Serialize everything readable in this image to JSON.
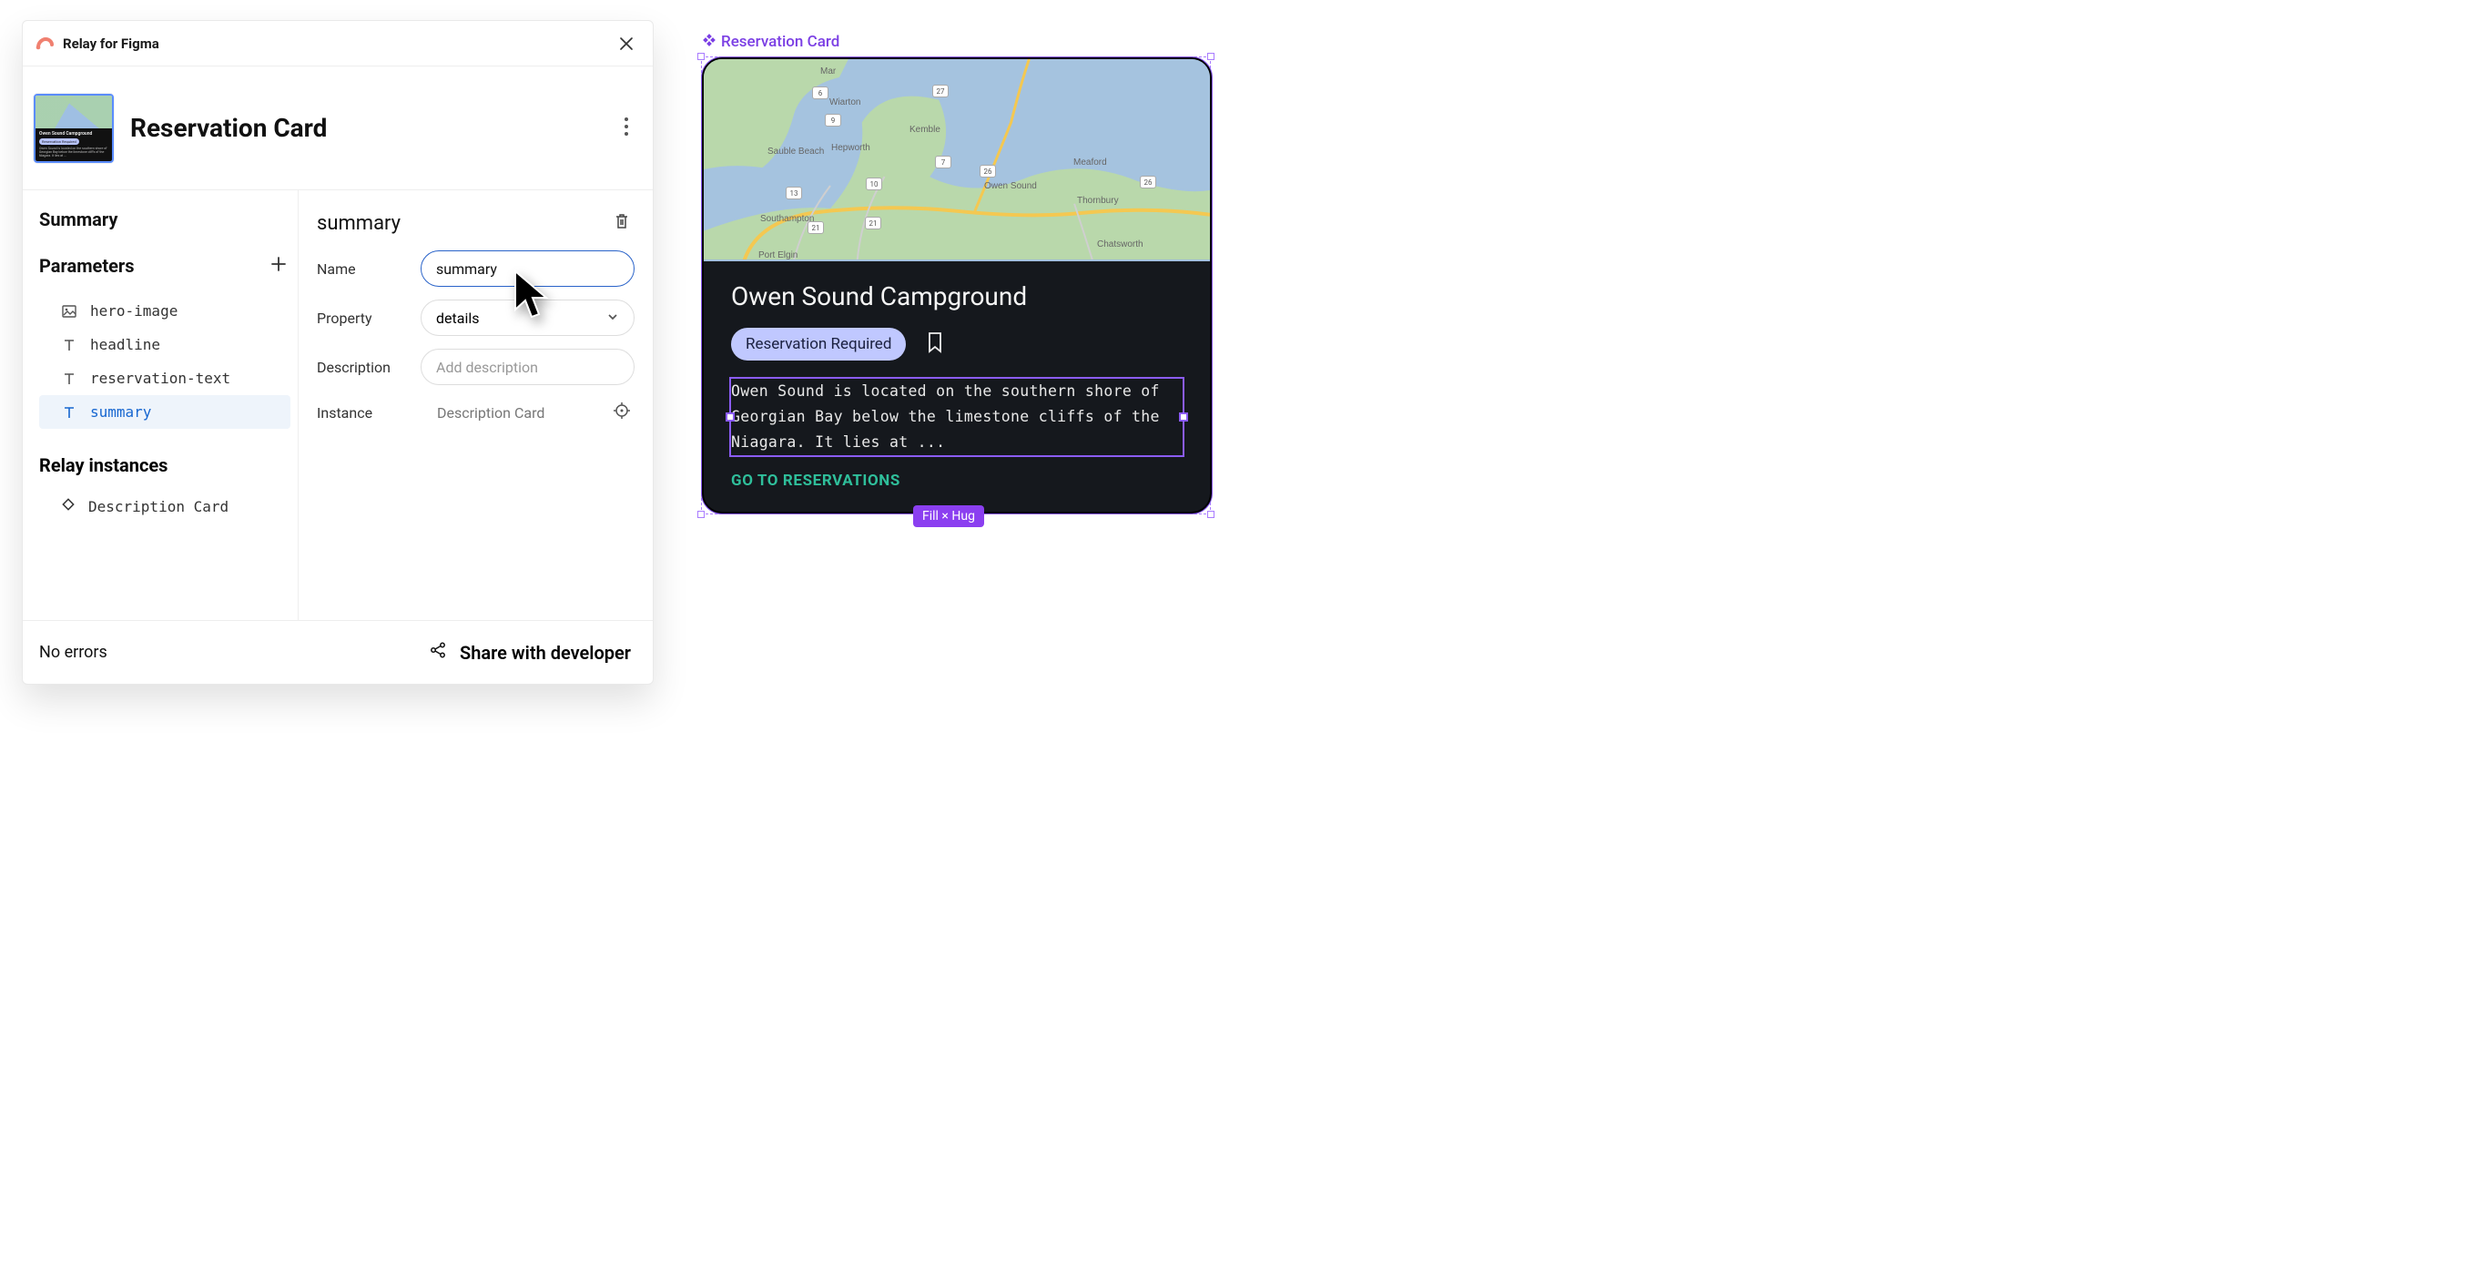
{
  "plugin": {
    "name": "Relay for Figma"
  },
  "component": {
    "title": "Reservation Card"
  },
  "sidebar": {
    "summary_label": "Summary",
    "parameters_label": "Parameters",
    "relay_instances_label": "Relay instances",
    "parameters": [
      {
        "icon": "image",
        "name": "hero-image"
      },
      {
        "icon": "text",
        "name": "headline"
      },
      {
        "icon": "text",
        "name": "reservation-text"
      },
      {
        "icon": "text",
        "name": "summary",
        "selected": true
      }
    ],
    "relay_instances": [
      {
        "icon": "diamond",
        "name": "Description Card"
      }
    ]
  },
  "detail": {
    "title": "summary",
    "fields": {
      "name_label": "Name",
      "name_value": "summary",
      "property_label": "Property",
      "property_value": "details",
      "description_label": "Description",
      "description_placeholder": "Add description",
      "instance_label": "Instance",
      "instance_value": "Description Card"
    }
  },
  "footer": {
    "status": "No errors",
    "share_label": "Share with developer"
  },
  "canvas": {
    "component_label": "Reservation Card",
    "size_badge": "Fill × Hug",
    "card": {
      "headline": "Owen Sound Campground",
      "reservation_badge": "Reservation Required",
      "summary": "Owen Sound is located on the southern shore of Georgian Bay below the limestone cliffs of the Niagara. It lies at ...",
      "cta": "GO TO RESERVATIONS"
    },
    "map_places": {
      "wiarton": "Wiarton",
      "mar": "Mar",
      "hepworth": "Hepworth",
      "sauble": "Sauble Beach",
      "kemble": "Kemble",
      "owensound": "Owen Sound",
      "meaford": "Meaford",
      "thornbury": "Thornbury",
      "southampton": "Southampton",
      "portelgin": "Port Elgin",
      "chatsworth": "Chatsworth"
    },
    "routes": {
      "r6": "6",
      "r9": "9",
      "r10": "10",
      "r13": "13",
      "r21_a": "21",
      "r21_b": "21",
      "r26_a": "26",
      "r26_b": "26",
      "r27": "27",
      "r7": "7"
    }
  }
}
